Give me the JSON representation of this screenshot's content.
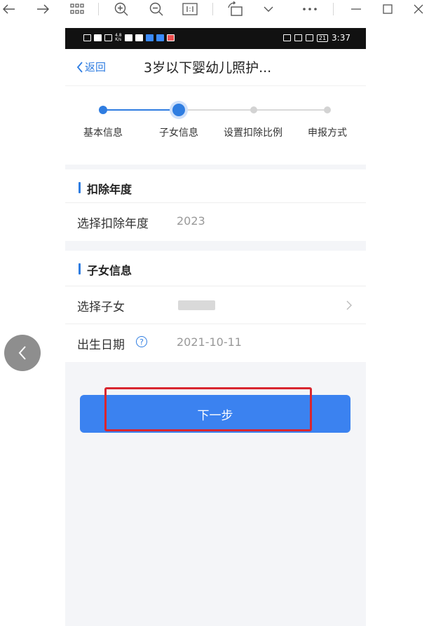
{
  "viewer": {
    "icons": [
      "back-arrow-icon",
      "forward-arrow-icon",
      "grid-icon",
      "zoom-in-icon",
      "zoom-out-icon",
      "actual-size-icon",
      "rotate-icon",
      "chevron-down-icon",
      "more-icon",
      "minimize-icon",
      "maximize-icon",
      "close-icon"
    ]
  },
  "statusbar": {
    "speed_top": "4.8",
    "speed_bottom": "K/s",
    "time": "3:37",
    "battery": "21"
  },
  "nav": {
    "back_label": "返回",
    "title": "3岁以下婴幼儿照护..."
  },
  "steps": [
    {
      "label": "基本信息",
      "state": "done"
    },
    {
      "label": "子女信息",
      "state": "active"
    },
    {
      "label": "设置扣除比例",
      "state": "pending"
    },
    {
      "label": "申报方式",
      "state": "pending"
    }
  ],
  "section_year": {
    "title": "扣除年度",
    "select_year_label": "选择扣除年度",
    "select_year_value": "2023"
  },
  "section_child": {
    "title": "子女信息",
    "select_child_label": "选择子女",
    "birth_label": "出生日期",
    "help_glyph": "?",
    "birth_value": "2021-10-11"
  },
  "next_button": {
    "label": "下一步"
  },
  "colors": {
    "accent": "#2f7de1",
    "button": "#3b82f0",
    "highlight": "#d8262f"
  }
}
